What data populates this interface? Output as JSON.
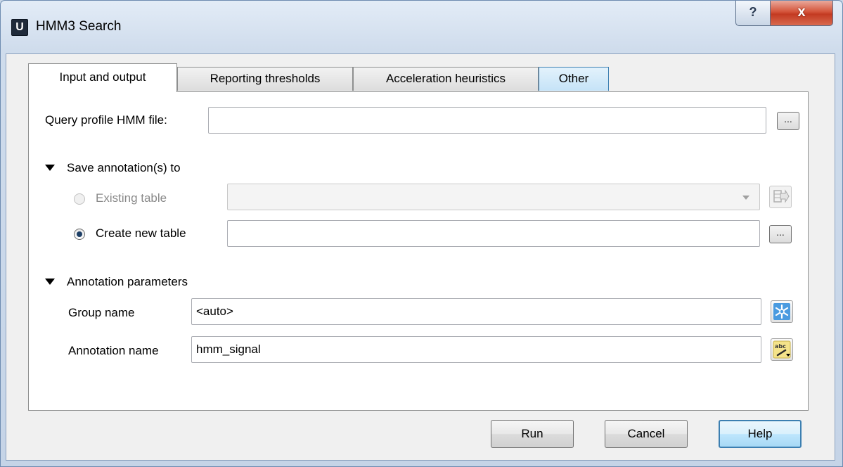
{
  "window": {
    "title": "HMM3 Search",
    "app_icon_letter": "U",
    "help_glyph": "?",
    "close_glyph": "x"
  },
  "tabs": [
    {
      "label": "Input and output",
      "active": true
    },
    {
      "label": "Reporting thresholds",
      "active": false
    },
    {
      "label": "Acceleration heuristics",
      "active": false
    },
    {
      "label": "Other",
      "active": false
    }
  ],
  "query": {
    "label": "Query profile HMM file:",
    "value": "",
    "browse_label": "..."
  },
  "save_section": {
    "header": "Save annotation(s) to",
    "existing_table": {
      "label": "Existing table",
      "selected": false,
      "enabled": false,
      "value": ""
    },
    "create_new_table": {
      "label": "Create new table",
      "selected": true,
      "value": "",
      "browse_label": "..."
    }
  },
  "annotation_params": {
    "header": "Annotation parameters",
    "group_name": {
      "label": "Group name",
      "value": "<auto>"
    },
    "annotation_name": {
      "label": "Annotation name",
      "value": "hmm_signal"
    }
  },
  "buttons": {
    "run": "Run",
    "cancel": "Cancel",
    "help": "Help"
  },
  "icons": {
    "open_table": "open-table-icon",
    "group_auto": "snowflake-icon",
    "name_suggest": "abc-pencil-icon"
  },
  "colors": {
    "accent": "#3c7fb1",
    "close": "#c33a22"
  }
}
